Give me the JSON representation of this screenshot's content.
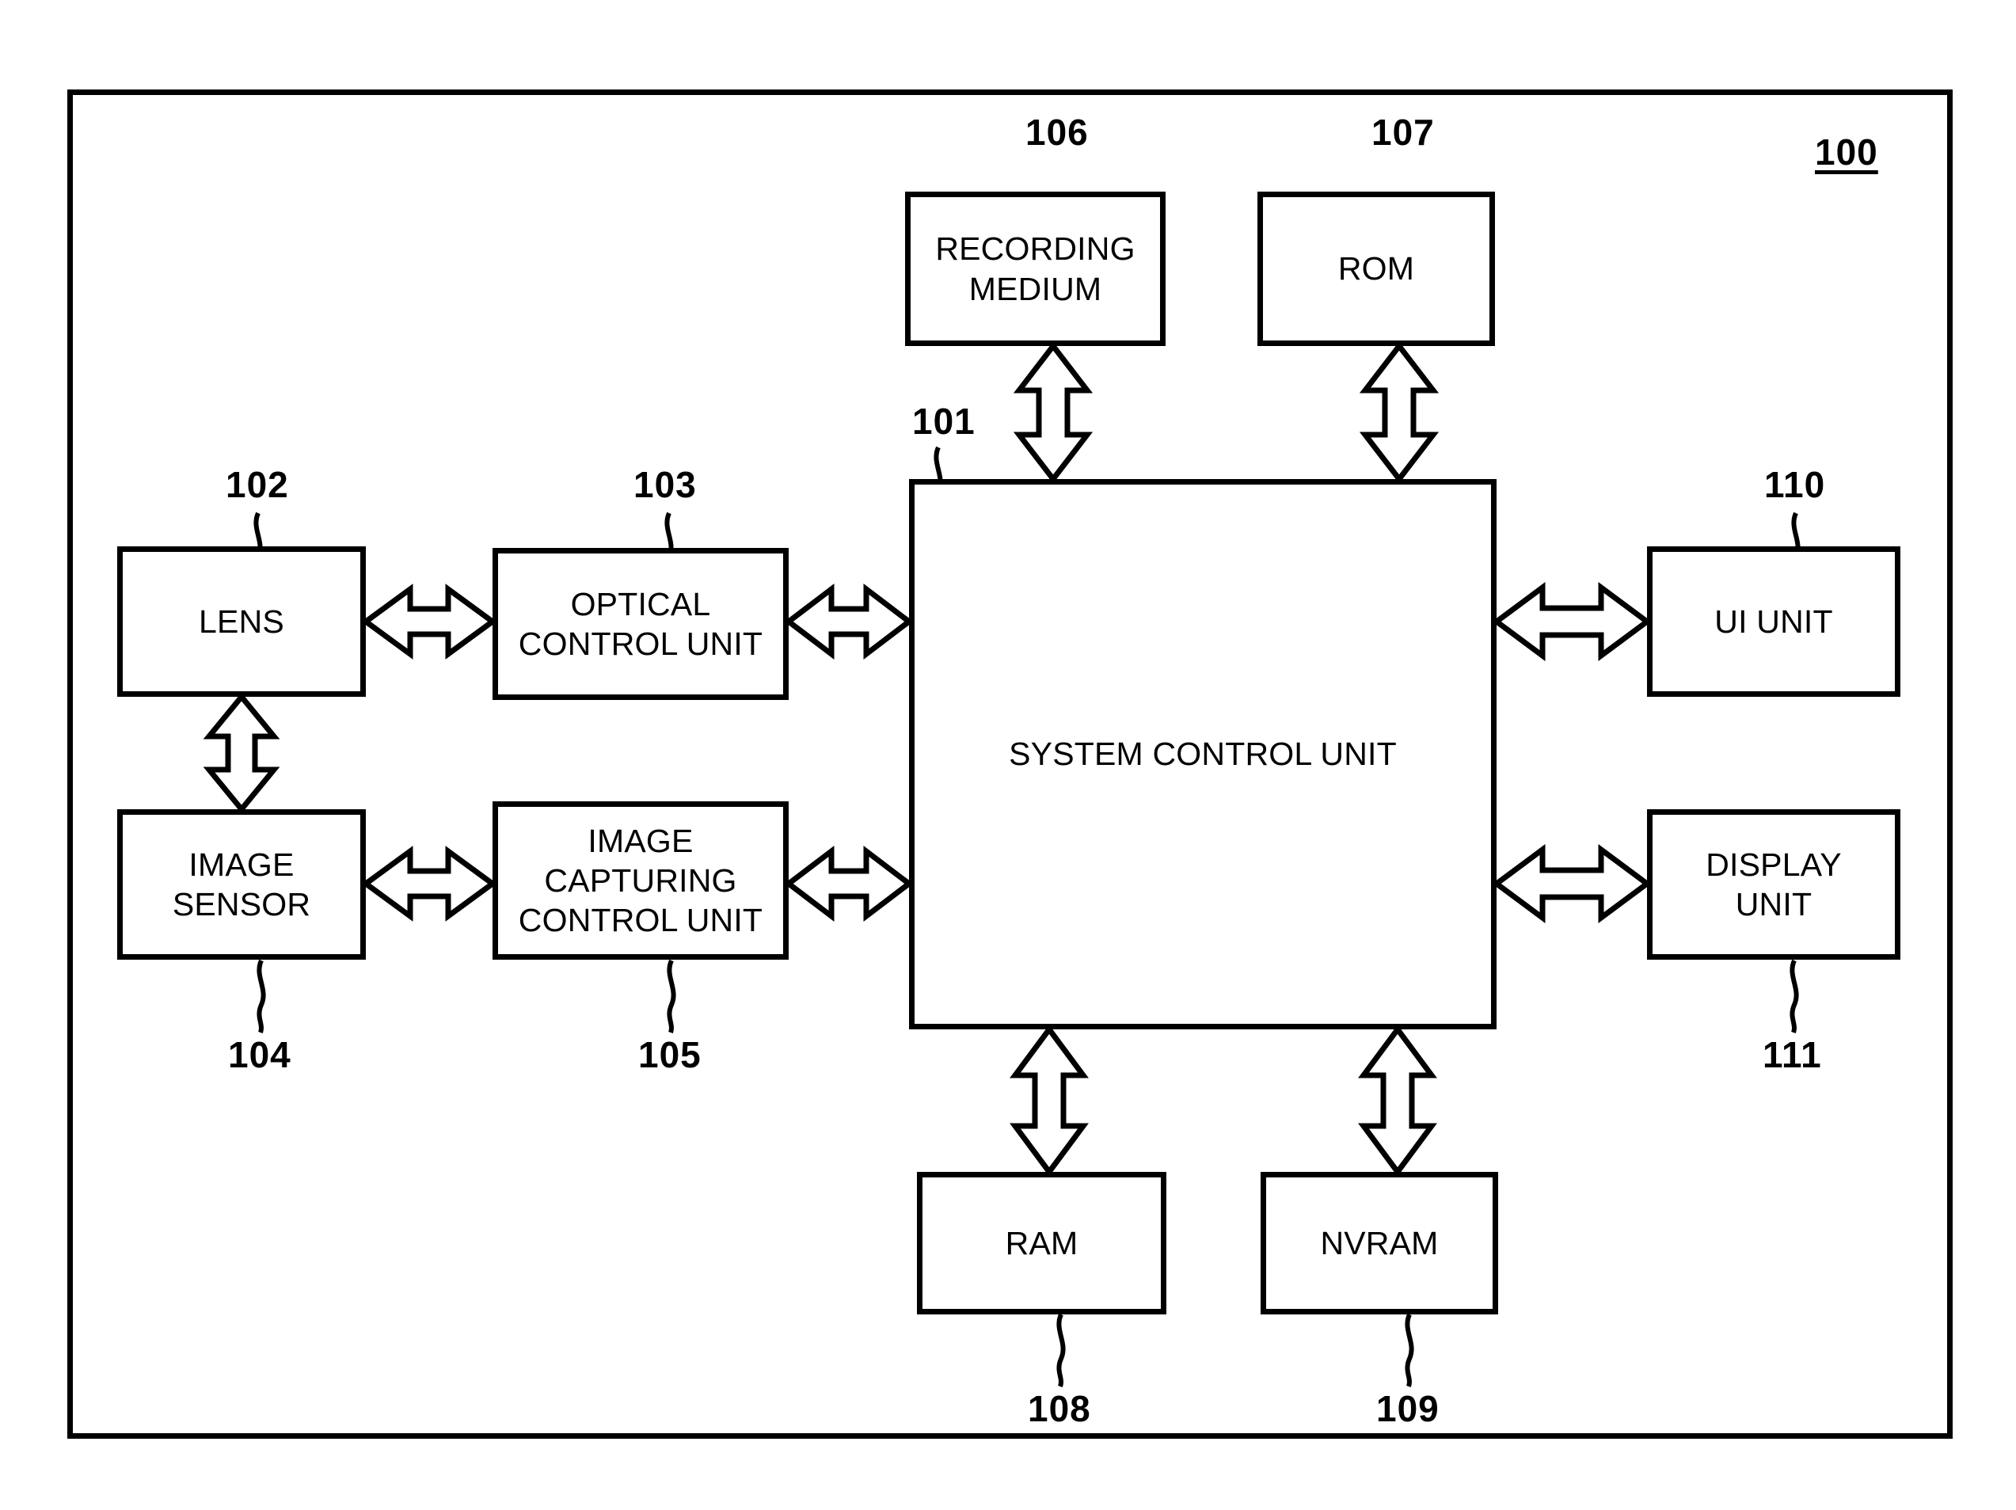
{
  "figure": {
    "type": "patent-block-diagram",
    "device_numeral": "100",
    "background_color": "#ffffff",
    "line_color": "#000000"
  },
  "blocks": {
    "recording_medium": {
      "label": "RECORDING\nMEDIUM",
      "numeral": "106"
    },
    "rom": {
      "label": "ROM",
      "numeral": "107"
    },
    "system_control": {
      "label": "SYSTEM CONTROL UNIT",
      "numeral": "101"
    },
    "lens": {
      "label": "LENS",
      "numeral": "102"
    },
    "optical_control": {
      "label": "OPTICAL\nCONTROL UNIT",
      "numeral": "103"
    },
    "image_sensor": {
      "label": "IMAGE\nSENSOR",
      "numeral": "104"
    },
    "image_capturing": {
      "label": "IMAGE\nCAPTURING\nCONTROL UNIT",
      "numeral": "105"
    },
    "ram": {
      "label": "RAM",
      "numeral": "108"
    },
    "nvram": {
      "label": "NVRAM",
      "numeral": "109"
    },
    "ui_unit": {
      "label": "UI UNIT",
      "numeral": "110"
    },
    "display_unit": {
      "label": "DISPLAY\nUNIT",
      "numeral": "111"
    }
  },
  "connections": [
    {
      "from": "recording_medium",
      "to": "system_control",
      "style": "double-headed-hollow",
      "orientation": "vertical"
    },
    {
      "from": "rom",
      "to": "system_control",
      "style": "double-headed-hollow",
      "orientation": "vertical"
    },
    {
      "from": "lens",
      "to": "optical_control",
      "style": "double-headed-hollow",
      "orientation": "horizontal"
    },
    {
      "from": "optical_control",
      "to": "system_control",
      "style": "double-headed-hollow",
      "orientation": "horizontal"
    },
    {
      "from": "lens",
      "to": "image_sensor",
      "style": "double-headed-hollow",
      "orientation": "vertical"
    },
    {
      "from": "image_sensor",
      "to": "image_capturing",
      "style": "double-headed-hollow",
      "orientation": "horizontal"
    },
    {
      "from": "image_capturing",
      "to": "system_control",
      "style": "double-headed-hollow",
      "orientation": "horizontal"
    },
    {
      "from": "system_control",
      "to": "ui_unit",
      "style": "double-headed-hollow",
      "orientation": "horizontal"
    },
    {
      "from": "system_control",
      "to": "display_unit",
      "style": "double-headed-hollow",
      "orientation": "horizontal"
    },
    {
      "from": "system_control",
      "to": "ram",
      "style": "double-headed-hollow",
      "orientation": "vertical"
    },
    {
      "from": "system_control",
      "to": "nvram",
      "style": "double-headed-hollow",
      "orientation": "vertical"
    }
  ]
}
